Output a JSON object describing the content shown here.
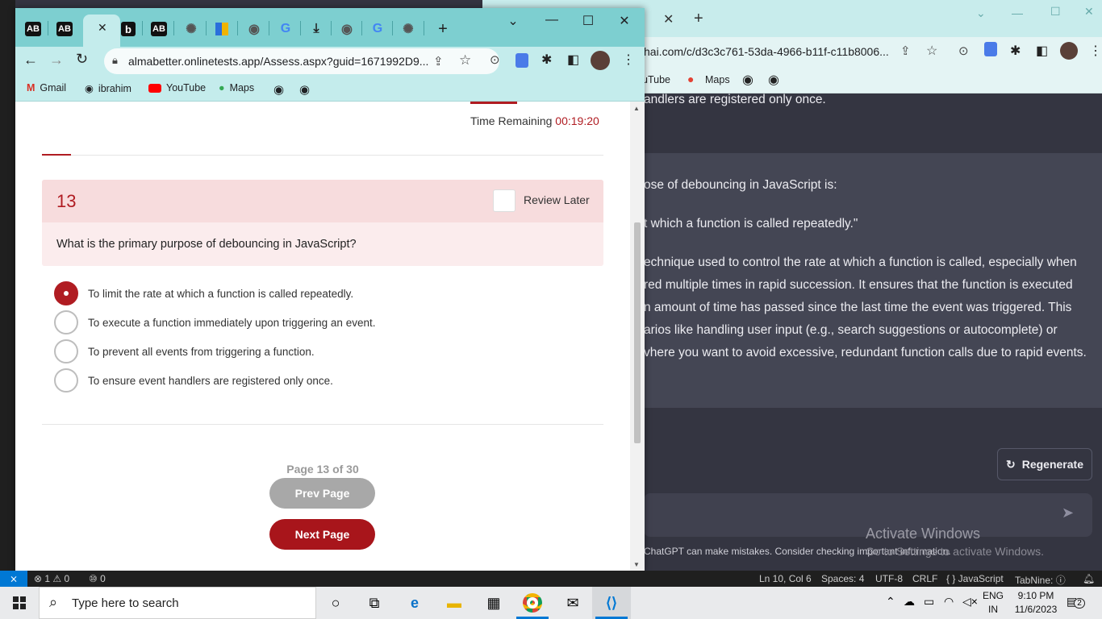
{
  "background_window": {
    "url": "hai.com/c/d3c3c761-53da-4966-b11f-c11b8006...",
    "bookmarks": [
      "uTube",
      "Maps"
    ],
    "lines": [
      "andlers are registered only once.",
      "ose of debouncing in JavaScript is:",
      "t which a function is called repeatedly.\"",
      "echnique used to control the rate at which a function is called, especially when",
      "red multiple times in rapid succession. It ensures that the function is executed",
      "n amount of time has passed since the last time the event was triggered. This",
      "arios like handling user input (e.g., search suggestions or autocomplete) or",
      "vhere you want to avoid excessive, redundant function calls due to rapid events."
    ],
    "regenerate_label": "Regenerate",
    "disclaimer": "ChatGPT can make mistakes. Consider checking important information.",
    "activate_title": "Activate Windows",
    "activate_sub": "Go to Settings to activate Windows."
  },
  "browser": {
    "tabs": [
      "AB",
      "AB",
      "b",
      "AB"
    ],
    "url": "almabetter.onlinetests.app/Assess.aspx?guid=1671992D9...",
    "bookmarks": [
      "Gmail",
      "ibrahim",
      "YouTube",
      "Maps"
    ]
  },
  "quiz": {
    "time_label": "Time Remaining ",
    "time_value": "00:19:20",
    "question_number": "13",
    "review_label": "Review Later",
    "question": "What is the primary purpose of debouncing in JavaScript?",
    "options": [
      "To limit the rate at which a function is called repeatedly.",
      "To execute a function immediately upon triggering an event.",
      "To prevent all events from triggering a function.",
      "To ensure event handlers are registered only once."
    ],
    "selected_option": 0,
    "page_info": "Page 13 of 30",
    "prev_label": "Prev Page",
    "next_label": "Next Page"
  },
  "statusbar": {
    "problems": "⊗ 1 ⚠ 0",
    "ports": "⑩ 0",
    "position": "Ln 10, Col 6",
    "spaces": "Spaces: 4",
    "encoding": "UTF-8",
    "eol": "CRLF",
    "language": "{ } JavaScript",
    "tabnine": "TabNine: ⓘ"
  },
  "taskbar": {
    "search_placeholder": "Type here to search",
    "lang": "ENG",
    "region": "IN",
    "time": "9:10 PM",
    "date": "11/6/2023",
    "notifications": "2"
  },
  "colors": {
    "accent_red": "#b01c22",
    "chrome_teal": "#7dcfd0",
    "chatgpt_bg": "#343541"
  }
}
